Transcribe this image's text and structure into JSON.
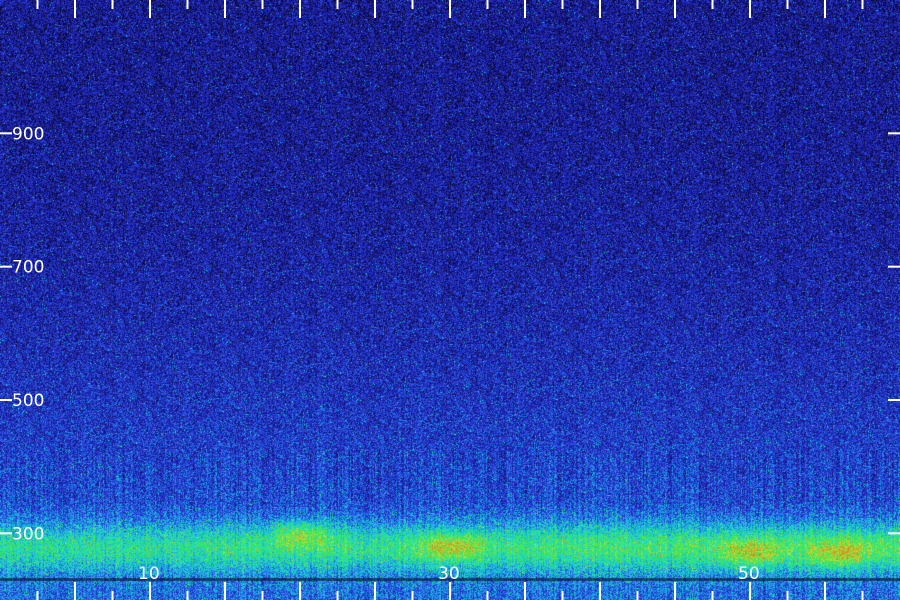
{
  "chart_data": {
    "type": "heatmap",
    "title": "",
    "xlabel": "",
    "ylabel": "",
    "xlim": [
      0,
      60
    ],
    "ylim": [
      200,
      1100
    ],
    "x_major_ticks": [
      5,
      10,
      15,
      20,
      25,
      30,
      35,
      40,
      45,
      50,
      55
    ],
    "x_labeled_ticks": [
      {
        "value": 10,
        "label": "10"
      },
      {
        "value": 30,
        "label": "30"
      },
      {
        "value": 50,
        "label": "50"
      }
    ],
    "x_minor_ticks": [
      2.5,
      7.5,
      12.5,
      17.5,
      22.5,
      27.5,
      32.5,
      37.5,
      42.5,
      47.5,
      52.5,
      57.5
    ],
    "y_ticks": [
      {
        "value": 300,
        "label": "300"
      },
      {
        "value": 500,
        "label": "500"
      },
      {
        "value": 700,
        "label": "700"
      },
      {
        "value": 900,
        "label": "900"
      }
    ],
    "energy_band": {
      "y_range": [
        240,
        320
      ],
      "peak_y": 280,
      "note": "strongest intensity in this band, brightening toward higher x"
    },
    "hot_spots": [
      {
        "x": 20,
        "y": 300
      },
      {
        "x": 30,
        "y": 280
      },
      {
        "x": 50,
        "y": 270
      },
      {
        "x": 56,
        "y": 270
      }
    ],
    "colormap": [
      "#07072e",
      "#1a1a9a",
      "#2b3fe0",
      "#1a9ee8",
      "#22e0c0",
      "#38e84a",
      "#c8e038",
      "#e07818"
    ],
    "grid": false,
    "legend": "none"
  }
}
